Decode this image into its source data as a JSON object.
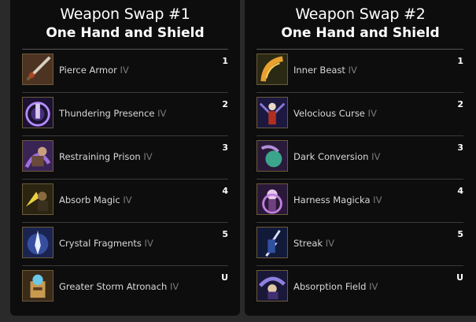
{
  "panels": [
    {
      "title": "Weapon Swap #1",
      "subtitle": "One Hand and Shield",
      "skills": [
        {
          "name": "Pierce Armor",
          "rank": "IV",
          "slot": "1",
          "icon": "sword-pierce-icon"
        },
        {
          "name": "Thundering Presence",
          "rank": "IV",
          "slot": "2",
          "icon": "thunder-aura-icon"
        },
        {
          "name": "Restraining Prison",
          "rank": "IV",
          "slot": "3",
          "icon": "prison-icon"
        },
        {
          "name": "Absorb Magic",
          "rank": "IV",
          "slot": "4",
          "icon": "absorb-shield-icon"
        },
        {
          "name": "Crystal Fragments",
          "rank": "IV",
          "slot": "5",
          "icon": "crystal-icon"
        },
        {
          "name": "Greater Storm Atronach",
          "rank": "IV",
          "slot": "U",
          "icon": "atronach-icon"
        }
      ]
    },
    {
      "title": "Weapon Swap #2",
      "subtitle": "One Hand and Shield",
      "skills": [
        {
          "name": "Inner Beast",
          "rank": "IV",
          "slot": "1",
          "icon": "beast-claw-icon"
        },
        {
          "name": "Velocious Curse",
          "rank": "IV",
          "slot": "2",
          "icon": "curse-icon"
        },
        {
          "name": "Dark Conversion",
          "rank": "IV",
          "slot": "3",
          "icon": "dark-orb-icon"
        },
        {
          "name": "Harness Magicka",
          "rank": "IV",
          "slot": "4",
          "icon": "magicka-icon"
        },
        {
          "name": "Streak",
          "rank": "IV",
          "slot": "5",
          "icon": "lightning-streak-icon"
        },
        {
          "name": "Absorption Field",
          "rank": "IV",
          "slot": "U",
          "icon": "field-icon"
        }
      ]
    }
  ]
}
